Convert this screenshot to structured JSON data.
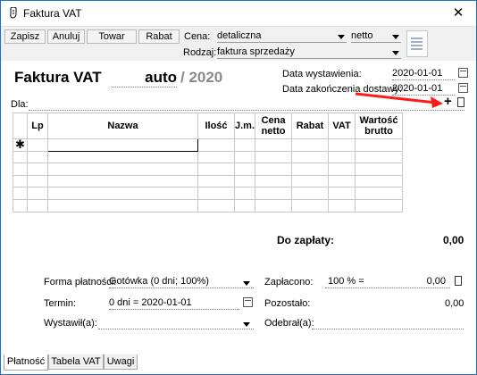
{
  "window": {
    "title": "Faktura VAT",
    "close": "✕"
  },
  "toolbar": {
    "buttons": [
      "Zapisz",
      "Anuluj",
      "Towar",
      "Rabat"
    ],
    "cena_label": "Cena:",
    "cena_value": "detaliczna",
    "netto_value": "netto",
    "rodzaj_label": "Rodzaj:",
    "rodzaj_value": "faktura sprzedaży"
  },
  "header": {
    "title": "Faktura VAT",
    "number": "auto",
    "year": "/ 2020",
    "issue_label": "Data wystawienia:",
    "issue_date": "2020-01-01",
    "delivery_label": "Data zakończenia dostawy:",
    "delivery_date": "2020-01-01",
    "for_label": "Dla:",
    "add_symbol": "+"
  },
  "table": {
    "columns": [
      "Lp",
      "Nazwa",
      "Ilość",
      "J.m.",
      "Cena netto",
      "Rabat",
      "VAT",
      "Wartość brutto"
    ],
    "new_row_marker": "✱",
    "rows": 6
  },
  "summary": {
    "label": "Do zapłaty:",
    "value": "0,00"
  },
  "payment": {
    "method_label": "Forma płatności:",
    "method_value": "Gotówka (0 dni; 100%)",
    "term_label": "Termin:",
    "term_value": "0 dni = 2020-01-01",
    "issuer_label": "Wystawił(a):",
    "issuer_value": "",
    "paid_label": "Zapłacono:",
    "paid_percent": "100 % =",
    "paid_value": "0,00",
    "remaining_label": "Pozostało:",
    "remaining_value": "0,00",
    "receiver_label": "Odebrał(a):",
    "receiver_value": ""
  },
  "tabs": [
    "Płatność",
    "Tabela VAT",
    "Uwagi"
  ],
  "colors": {
    "annotation_arrow": "#ff1a1a",
    "window_border": "#1a73c8"
  }
}
